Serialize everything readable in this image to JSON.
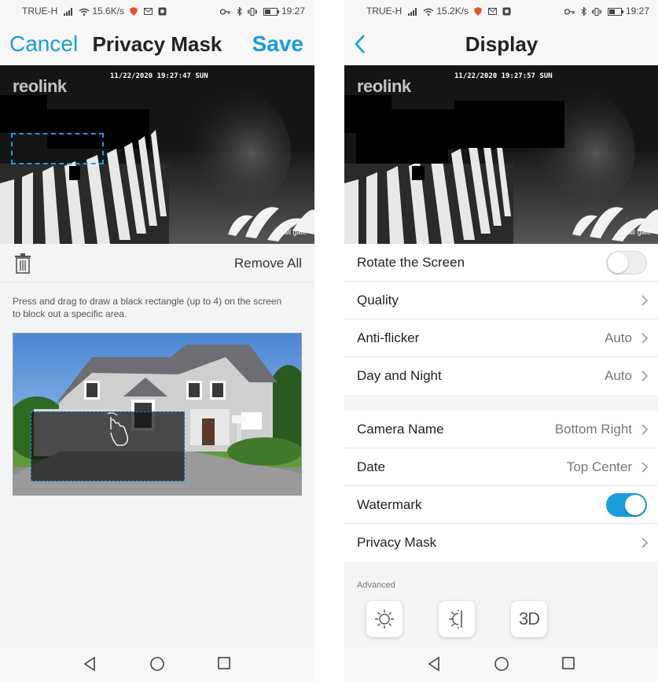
{
  "left": {
    "status": {
      "carrier": "TRUE-H",
      "speed": "15.6K/s",
      "time": "19:27"
    },
    "nav": {
      "cancel": "Cancel",
      "title": "Privacy Mask",
      "save": "Save"
    },
    "camera": {
      "logo": "reolink",
      "timestamp": "11/22/2020 19:27:47 SUN",
      "name": "hall gate"
    },
    "toolbar": {
      "remove_all": "Remove All"
    },
    "instruction": "Press and drag to draw a black rectangle (up to 4) on the screen to block out a specific area."
  },
  "right": {
    "status": {
      "carrier": "TRUE-H",
      "speed": "15.2K/s",
      "time": "19:27"
    },
    "nav": {
      "title": "Display"
    },
    "camera": {
      "logo": "reolink",
      "timestamp": "11/22/2020 19:27:57 SUN",
      "name": "hall gate"
    },
    "settings": {
      "rotate": {
        "label": "Rotate the Screen",
        "on": false
      },
      "quality": {
        "label": "Quality"
      },
      "anti_flicker": {
        "label": "Anti-flicker",
        "value": "Auto"
      },
      "day_night": {
        "label": "Day and Night",
        "value": "Auto"
      },
      "camera_name": {
        "label": "Camera Name",
        "value": "Bottom Right"
      },
      "date": {
        "label": "Date",
        "value": "Top Center"
      },
      "watermark": {
        "label": "Watermark",
        "on": true
      },
      "privacy_mask": {
        "label": "Privacy Mask"
      }
    },
    "advanced": {
      "label": "Advanced",
      "btn_3d": "3D"
    }
  },
  "colors": {
    "accent": "#1a9cdc",
    "background": "#f3f4f6"
  }
}
